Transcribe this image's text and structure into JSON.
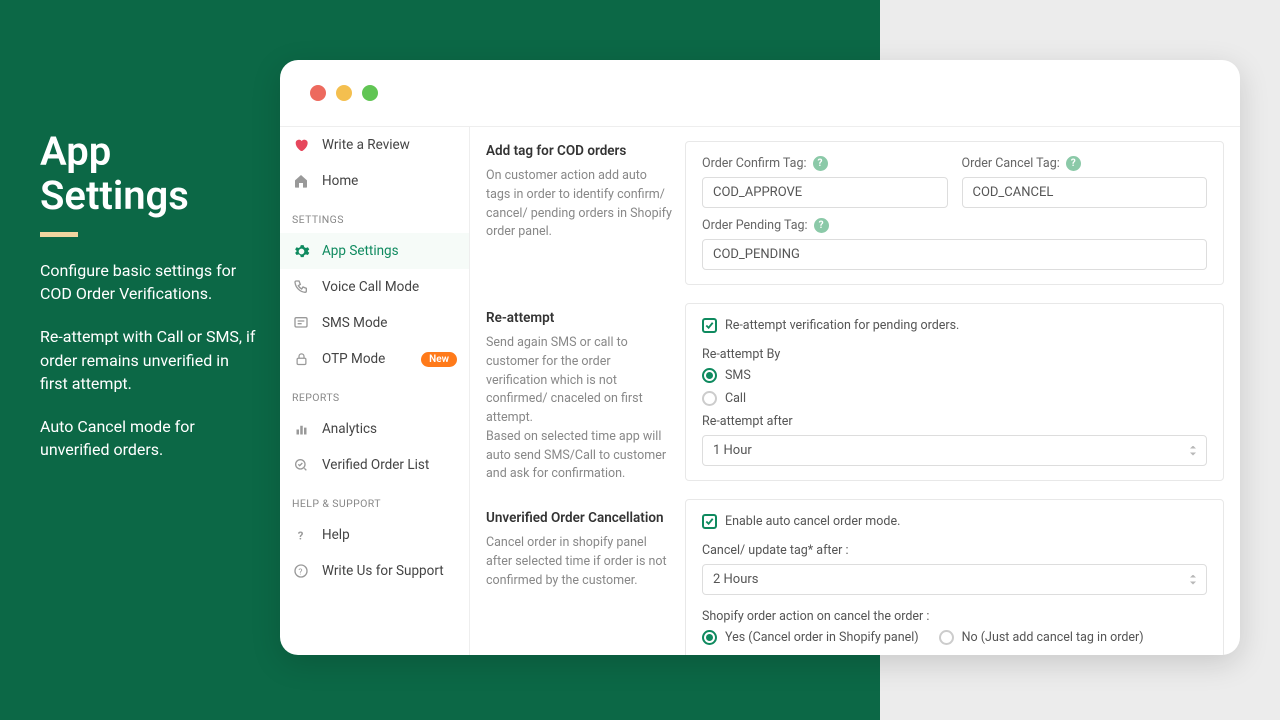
{
  "hero": {
    "title": "App Settings",
    "p1": "Configure basic settings for COD Order Verifications.",
    "p2": "Re-attempt with Call or SMS, if order remains unverified in first attempt.",
    "p3": "Auto Cancel mode for unverified orders."
  },
  "sidebar": {
    "write_review": "Write a Review",
    "home": "Home",
    "settings_head": "SETTINGS",
    "app_settings": "App Settings",
    "voice": "Voice Call Mode",
    "sms": "SMS Mode",
    "otp": "OTP Mode",
    "otp_badge": "New",
    "reports_head": "REPORTS",
    "analytics": "Analytics",
    "verified": "Verified Order List",
    "help_head": "HELP & SUPPORT",
    "help": "Help",
    "write_us": "Write Us for Support"
  },
  "sec1": {
    "title": "Add tag for COD orders",
    "desc": "On customer action add auto tags in order to identify confirm/ cancel/ pending orders in Shopify order panel.",
    "confirm_lbl": "Order Confirm Tag:",
    "confirm_val": "COD_APPROVE",
    "cancel_lbl": "Order Cancel Tag:",
    "cancel_val": "COD_CANCEL",
    "pending_lbl": "Order Pending Tag:",
    "pending_val": "COD_PENDING"
  },
  "sec2": {
    "title": "Re-attempt",
    "desc": "Send again SMS or call to customer for the order verification which is not confirmed/ cnaceled on first attempt.\nBased on selected time app will auto send SMS/Call to customer and ask for confirmation.",
    "cbx": "Re-attempt verification for pending orders.",
    "by_lbl": "Re-attempt By",
    "opt_sms": "SMS",
    "opt_call": "Call",
    "after_lbl": "Re-attempt after",
    "after_val": "1 Hour"
  },
  "sec3": {
    "title": "Unverified Order Cancellation",
    "desc": "Cancel order in shopify panel after selected time if order is not confirmed by the customer.",
    "cbx": "Enable auto cancel order mode.",
    "after_lbl": "Cancel/ update tag* after :",
    "after_val": "2 Hours",
    "action_lbl": "Shopify order action on cancel the order :",
    "opt_yes": "Yes (Cancel order in Shopify panel)",
    "opt_no": "No (Just add cancel tag in order)"
  }
}
